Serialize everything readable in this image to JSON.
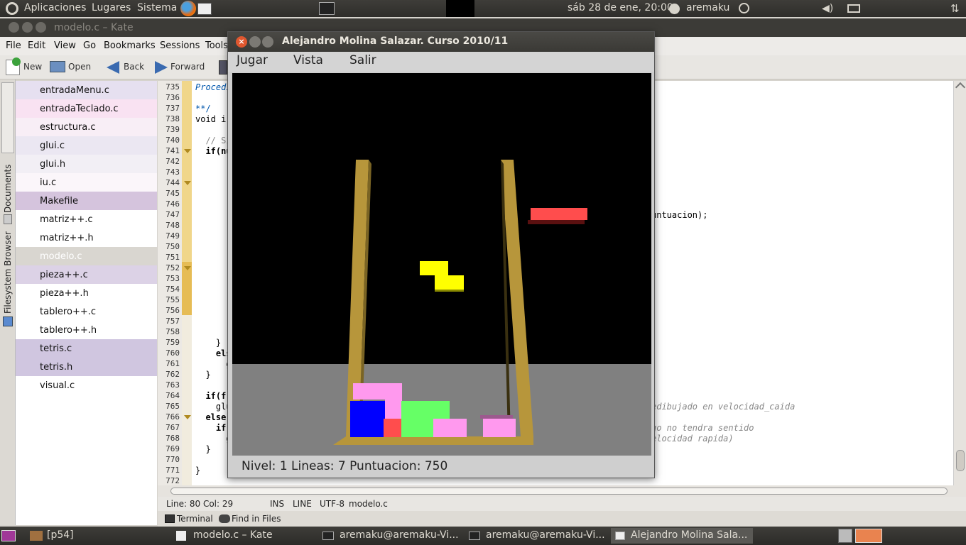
{
  "top_panel": {
    "menus": [
      "Aplicaciones",
      "Lugares",
      "Sistema"
    ],
    "clock": "sáb 28 de ene, 20:00",
    "user": "aremaku"
  },
  "kate": {
    "title": "modelo.c – Kate",
    "menu": [
      "File",
      "Edit",
      "View",
      "Go",
      "Bookmarks",
      "Sessions",
      "Tools"
    ],
    "toolbar": {
      "new": "New",
      "open": "Open",
      "back": "Back",
      "forward": "Forward"
    },
    "side_tabs": [
      "Documents",
      "Filesystem Browser"
    ],
    "documents": [
      {
        "name": "entradaMenu.c",
        "bg": "#e6e0f0"
      },
      {
        "name": "entradaTeclado.c",
        "bg": "#f9e2f2"
      },
      {
        "name": "estructura.c",
        "bg": "#f8eef6"
      },
      {
        "name": "glui.c",
        "bg": "#ebe7f2"
      },
      {
        "name": "glui.h",
        "bg": "#f2eff5"
      },
      {
        "name": "iu.c",
        "bg": "#fbf6fa"
      },
      {
        "name": "Makefile",
        "bg": "#d5c4dd"
      },
      {
        "name": "matriz++.c",
        "bg": "#ffffff"
      },
      {
        "name": "matriz++.h",
        "bg": "#ffffff"
      },
      {
        "name": "modelo.c",
        "bg": "#d9d6d0"
      },
      {
        "name": "pieza++.c",
        "bg": "#dcd2e6"
      },
      {
        "name": "pieza++.h",
        "bg": "#ffffff"
      },
      {
        "name": "tablero++.c",
        "bg": "#ffffff"
      },
      {
        "name": "tablero++.h",
        "bg": "#ffffff"
      },
      {
        "name": "tetris.c",
        "bg": "#d0c6e0"
      },
      {
        "name": "tetris.h",
        "bg": "#d0c6e0"
      },
      {
        "name": "visual.c",
        "bg": "#ffffff"
      }
    ],
    "line_numbers": [
      "735",
      "736",
      "737",
      "738",
      "739",
      "740",
      "741",
      "742",
      "743",
      "744",
      "745",
      "746",
      "747",
      "748",
      "749",
      "750",
      "751",
      "752",
      "753",
      "754",
      "755",
      "756",
      "757",
      "758",
      "759",
      "760",
      "761",
      "762",
      "763",
      "764",
      "765",
      "766",
      "767",
      "768",
      "769",
      "770",
      "771",
      "772"
    ],
    "code_left": [
      {
        "n": "735",
        "text": "Procedi"
      },
      {
        "n": "737",
        "text": "**/"
      },
      {
        "n": "738",
        "text": "void i("
      },
      {
        "n": "740",
        "text": "  // Si"
      },
      {
        "n": "741",
        "text": "  if(nu"
      },
      {
        "n": "759",
        "text": "    }"
      },
      {
        "n": "760",
        "text": "    els"
      },
      {
        "n": "761",
        "text": "      g"
      },
      {
        "n": "762",
        "text": "  }"
      },
      {
        "n": "764",
        "text": "  if(f"
      },
      {
        "n": "765",
        "text": "    glu"
      },
      {
        "n": "766",
        "text": "  else"
      },
      {
        "n": "767",
        "text": "    if"
      },
      {
        "n": "768",
        "text": "      g"
      },
      {
        "n": "769",
        "text": "  }"
      },
      {
        "n": "771",
        "text": "}"
      }
    ],
    "code_right": [
      {
        "n": "747",
        "text": "untuacion);"
      },
      {
        "n": "765",
        "text": "edibujado en velocidad_caida"
      },
      {
        "n": "767",
        "text": "go no tendra sentido"
      },
      {
        "n": "768",
        "text": "elocidad rapida)"
      }
    ],
    "status": {
      "position": "Line: 80 Col: 29",
      "mode": "INS",
      "sel": "LINE",
      "encoding": "UTF-8",
      "file": "modelo.c"
    },
    "toolviews": {
      "terminal": "Terminal",
      "find": "Find in Files"
    }
  },
  "game": {
    "title": "Alejandro Molina Salazar. Curso 2010/11",
    "menu": [
      "Jugar",
      "Vista",
      "Salir"
    ],
    "status": "Nivel: 1 Lineas: 7 Puntuacion: 750",
    "colors": {
      "frame": "#b7963b",
      "falling": "#ffff00",
      "next": "#ff4d4d",
      "pink": "#ff99ee",
      "blue": "#0000ff",
      "green": "#66ff66",
      "red": "#ff4d4d"
    }
  },
  "taskbar": {
    "items": [
      "[p54]",
      "modelo.c – Kate",
      "aremaku@aremaku-Vi...",
      "aremaku@aremaku-Vi...",
      "Alejandro Molina Sala..."
    ]
  }
}
